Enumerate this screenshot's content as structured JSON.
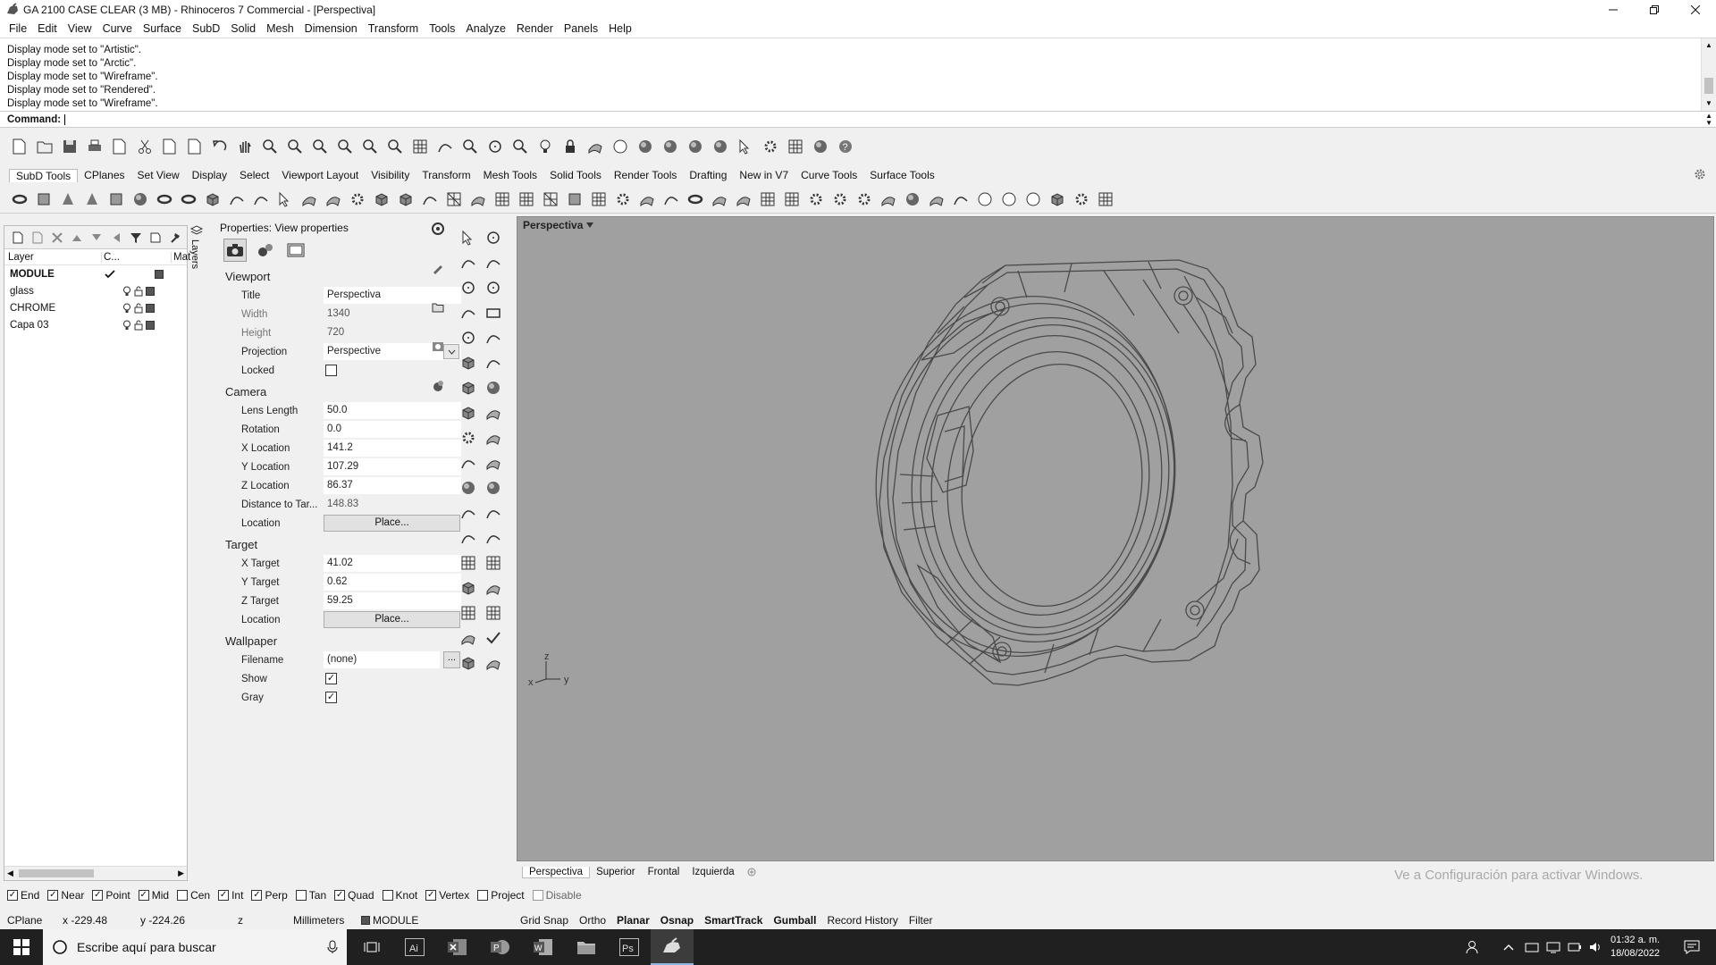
{
  "window": {
    "title": "GA 2100 CASE CLEAR (3 MB) - Rhinoceros 7 Commercial - [Perspectiva]",
    "controls": [
      "minimize-icon",
      "restore-icon",
      "close-icon"
    ]
  },
  "menu": [
    "File",
    "Edit",
    "View",
    "Curve",
    "Surface",
    "SubD",
    "Solid",
    "Mesh",
    "Dimension",
    "Transform",
    "Tools",
    "Analyze",
    "Render",
    "Panels",
    "Help"
  ],
  "command_history": [
    "Display mode set to \"Artistic\".",
    "Display mode set to \"Arctic\".",
    "Display mode set to \"Wireframe\".",
    "Display mode set to \"Rendered\".",
    "Display mode set to \"Wireframe\"."
  ],
  "command_prompt": "Command:",
  "toolbar_tabs": [
    "SubD Tools",
    "CPlanes",
    "Set View",
    "Display",
    "Select",
    "Viewport Layout",
    "Visibility",
    "Transform",
    "Mesh Tools",
    "Solid Tools",
    "Render Tools",
    "Drafting",
    "New in V7",
    "Curve Tools",
    "Surface Tools"
  ],
  "layers": {
    "tab_label": "Layers",
    "headers": {
      "layer": "Layer",
      "current": "C...",
      "material": "Mat"
    },
    "rows": [
      {
        "name": "MODULE",
        "current": true
      },
      {
        "name": "glass",
        "current": false
      },
      {
        "name": "CHROME",
        "current": false
      },
      {
        "name": "Capa 03",
        "current": false
      }
    ]
  },
  "properties": {
    "title": "Properties: View properties",
    "viewport": {
      "section": "Viewport",
      "title_label": "Title",
      "title_value": "Perspectiva",
      "width_label": "Width",
      "width_value": "1340",
      "height_label": "Height",
      "height_value": "720",
      "projection_label": "Projection",
      "projection_value": "Perspective",
      "locked_label": "Locked",
      "locked": false
    },
    "camera": {
      "section": "Camera",
      "lens_label": "Lens Length",
      "lens_value": "50.0",
      "rotation_label": "Rotation",
      "rotation_value": "0.0",
      "x_label": "X Location",
      "x_value": "141.2",
      "y_label": "Y Location",
      "y_value": "107.29",
      "z_label": "Z Location",
      "z_value": "86.37",
      "dist_label": "Distance to Tar...",
      "dist_value": "148.83",
      "loc_label": "Location",
      "loc_button": "Place..."
    },
    "target": {
      "section": "Target",
      "x_label": "X Target",
      "x_value": "41.02",
      "y_label": "Y Target",
      "y_value": "0.62",
      "z_label": "Z Target",
      "z_value": "59.25",
      "loc_label": "Location",
      "loc_button": "Place..."
    },
    "wallpaper": {
      "section": "Wallpaper",
      "file_label": "Filename",
      "file_value": "(none)",
      "file_button": "...",
      "show_label": "Show",
      "show": true,
      "gray_label": "Gray",
      "gray": true
    }
  },
  "viewport": {
    "title": "Perspectiva",
    "background": "#a0a0a0",
    "wire_color": "#4a4a4a",
    "axes": {
      "z": "z",
      "x": "x",
      "y": "y"
    },
    "tabs": [
      "Perspectiva",
      "Superior",
      "Frontal",
      "Izquierda"
    ],
    "active_tab": "Perspectiva",
    "watermark": "Ve a Configuración para activar Windows."
  },
  "osnaps": [
    {
      "label": "End",
      "checked": true
    },
    {
      "label": "Near",
      "checked": true
    },
    {
      "label": "Point",
      "checked": true
    },
    {
      "label": "Mid",
      "checked": true
    },
    {
      "label": "Cen",
      "checked": false
    },
    {
      "label": "Int",
      "checked": true
    },
    {
      "label": "Perp",
      "checked": true
    },
    {
      "label": "Tan",
      "checked": false
    },
    {
      "label": "Quad",
      "checked": true
    },
    {
      "label": "Knot",
      "checked": false
    },
    {
      "label": "Vertex",
      "checked": true
    },
    {
      "label": "Project",
      "checked": false
    },
    {
      "label": "Disable",
      "checked": false
    }
  ],
  "status": {
    "cplane": "CPlane",
    "x": "x -229.48",
    "y": "y -224.26",
    "z": "z",
    "units": "Millimeters",
    "layer": "MODULE",
    "toggles": [
      {
        "label": "Grid Snap",
        "bold": false
      },
      {
        "label": "Ortho",
        "bold": false
      },
      {
        "label": "Planar",
        "bold": true
      },
      {
        "label": "Osnap",
        "bold": true
      },
      {
        "label": "SmartTrack",
        "bold": true
      },
      {
        "label": "Gumball",
        "bold": true
      },
      {
        "label": "Record History",
        "bold": false
      },
      {
        "label": "Filter",
        "bold": false
      }
    ]
  },
  "taskbar": {
    "search_placeholder": "Escribe aquí para buscar",
    "time": "01:32 a. m.",
    "date": "18/08/2022"
  }
}
